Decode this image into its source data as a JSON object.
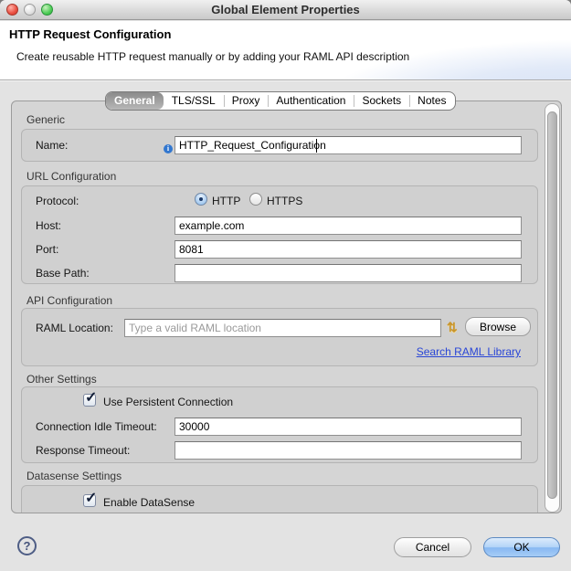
{
  "window": {
    "title": "Global Element Properties"
  },
  "header": {
    "title": "HTTP Request Configuration",
    "subtitle": "Create reusable HTTP request manually or by adding your RAML API description"
  },
  "tabs": [
    {
      "label": "General",
      "selected": true
    },
    {
      "label": "TLS/SSL",
      "selected": false
    },
    {
      "label": "Proxy",
      "selected": false
    },
    {
      "label": "Authentication",
      "selected": false
    },
    {
      "label": "Sockets",
      "selected": false
    },
    {
      "label": "Notes",
      "selected": false
    }
  ],
  "sections": {
    "generic": {
      "title": "Generic",
      "name_label": "Name:",
      "name_value": "HTTP_Request_Configuration"
    },
    "url": {
      "title": "URL Configuration",
      "protocol_label": "Protocol:",
      "options": [
        {
          "label": "HTTP",
          "checked": true
        },
        {
          "label": "HTTPS",
          "checked": false
        }
      ],
      "host_label": "Host:",
      "host_value": "example.com",
      "port_label": "Port:",
      "port_value": "8081",
      "base_path_label": "Base Path:",
      "base_path_value": ""
    },
    "api": {
      "title": "API Configuration",
      "raml_label": "RAML Location:",
      "raml_placeholder": "Type a valid RAML location",
      "browse_label": "Browse",
      "search_link": "Search RAML Library"
    },
    "other": {
      "title": "Other Settings",
      "persistent_label": "Use Persistent Connection",
      "persistent_checked": true,
      "idle_label": "Connection Idle Timeout:",
      "idle_value": "30000",
      "response_label": "Response Timeout:",
      "response_value": ""
    },
    "datasense": {
      "title": "Datasense Settings",
      "enable_label": "Enable DataSense",
      "enable_checked": true
    }
  },
  "icons": {
    "info": "i",
    "sync": "⇅",
    "help": "?"
  },
  "footer": {
    "cancel_label": "Cancel",
    "ok_label": "OK"
  },
  "colors": {
    "link": "#2a46d6",
    "selected_tab": "#9a9a9a",
    "ok_button": "#87b8f2",
    "accent_blue": "#3277cf"
  }
}
